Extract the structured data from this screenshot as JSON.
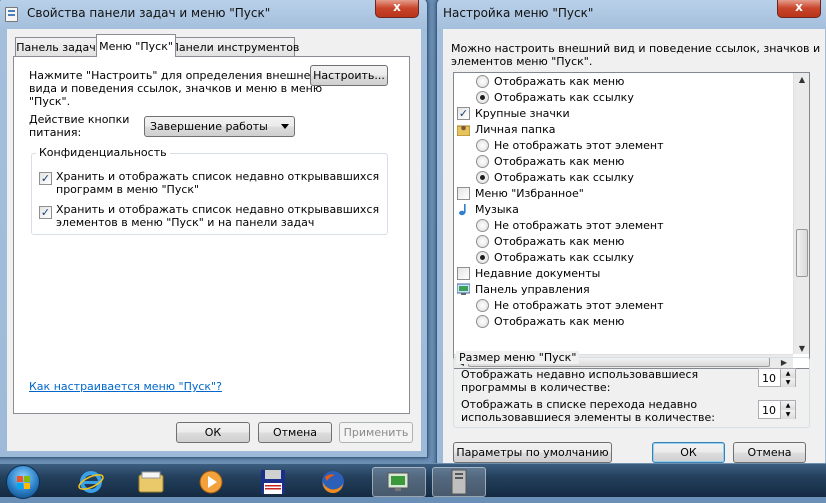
{
  "left_window": {
    "title": "Свойства панели задач и меню \"Пуск\"",
    "close": "x",
    "tabs": [
      {
        "label": "Панель задач"
      },
      {
        "label": "Меню \"Пуск\""
      },
      {
        "label": "Панели инструментов"
      }
    ],
    "description": [
      "Нажмите \"Настроить\" для определения внешнего",
      "вида и поведения ссылок, значков и меню в меню",
      "\"Пуск\"."
    ],
    "customize_button": "Настроить...",
    "power_label": [
      "Действие кнопки",
      "питания:"
    ],
    "power_value": "Завершение работы",
    "privacy": {
      "title": "Конфиденциальность",
      "items": [
        {
          "lines": [
            "Хранить и отображать список недавно открывавшихся",
            "программ в меню \"Пуск\""
          ],
          "checked": true
        },
        {
          "lines": [
            "Хранить и отображать список недавно открывавшихся",
            "элементов в меню \"Пуск\" и на панели задач"
          ],
          "checked": true
        }
      ]
    },
    "help_link": "Как настраивается меню \"Пуск\"?",
    "buttons": {
      "ok": "ОК",
      "cancel": "Отмена",
      "apply": "Применить"
    }
  },
  "right_window": {
    "title": "Настройка меню \"Пуск\"",
    "close": "x",
    "description": [
      "Можно настроить внешний вид и поведение ссылок, значков и",
      "элементов меню \"Пуск\"."
    ],
    "items": [
      {
        "kind": "radio",
        "label": "Отображать как меню",
        "checked": false
      },
      {
        "kind": "radio",
        "label": "Отображать как ссылку",
        "checked": true
      },
      {
        "kind": "check",
        "label": "Крупные значки",
        "checked": true
      },
      {
        "kind": "header",
        "label": "Личная папка",
        "icon": "folder-user-icon"
      },
      {
        "kind": "radio",
        "label": "Не отображать этот элемент",
        "checked": false
      },
      {
        "kind": "radio",
        "label": "Отображать как меню",
        "checked": false
      },
      {
        "kind": "radio",
        "label": "Отображать как ссылку",
        "checked": true
      },
      {
        "kind": "check",
        "label": "Меню \"Избранное\"",
        "checked": false
      },
      {
        "kind": "header",
        "label": "Музыка",
        "icon": "music-note-icon"
      },
      {
        "kind": "radio",
        "label": "Не отображать этот элемент",
        "checked": false
      },
      {
        "kind": "radio",
        "label": "Отображать как меню",
        "checked": false
      },
      {
        "kind": "radio",
        "label": "Отображать как ссылку",
        "checked": true
      },
      {
        "kind": "check",
        "label": "Недавние документы",
        "checked": false
      },
      {
        "kind": "header",
        "label": "Панель управления",
        "icon": "control-panel-icon"
      },
      {
        "kind": "radio",
        "label": "Не отображать этот элемент",
        "checked": false
      },
      {
        "kind": "radio",
        "label": "Отображать как меню",
        "checked": false
      }
    ],
    "size_group": {
      "title": "Размер меню \"Пуск\"",
      "recent_programs_label": [
        "Отображать недавно использовавшиеся",
        "программы в количестве:"
      ],
      "recent_programs_value": "10",
      "jump_list_label": [
        "Отображать в списке перехода недавно",
        "использовавшиеся элементы в количестве:"
      ],
      "jump_list_value": "10"
    },
    "buttons": {
      "defaults": "Параметры по умолчанию",
      "ok": "ОК",
      "cancel": "Отмена"
    }
  },
  "taskbar": {
    "icons": [
      "windows-start-icon",
      "internet-explorer-icon",
      "file-explorer-icon",
      "media-player-icon",
      "floppy-disk-icon",
      "firefox-icon",
      "control-panel-icon",
      "computer-tower-icon"
    ]
  }
}
